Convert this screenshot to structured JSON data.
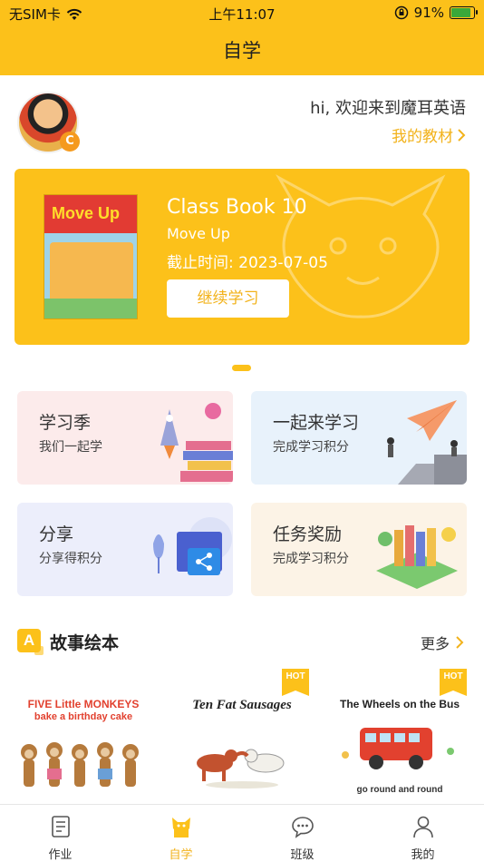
{
  "status_bar": {
    "carrier": "无SIM卡",
    "time": "上午11:07",
    "battery": "91%",
    "battery_level": 0.91
  },
  "nav": {
    "title": "自学"
  },
  "profile": {
    "greeting": "hi, 欢迎来到魔耳英语",
    "my_books_link": "我的教材"
  },
  "banner": {
    "cover_title": "Move Up",
    "title": "Class Book 10",
    "subtitle": "Move Up",
    "deadline": "截止时间: 2023-07-05",
    "continue_button": "继续学习"
  },
  "cards": [
    {
      "title": "学习季",
      "subtitle": "我们一起学",
      "icon": "rocket-books-illustration"
    },
    {
      "title": "一起来学习",
      "subtitle": "完成学习积分",
      "icon": "paper-plane-people-illustration"
    },
    {
      "title": "分享",
      "subtitle": "分享得积分",
      "icon": "share-folder-illustration"
    },
    {
      "title": "任务奖励",
      "subtitle": "完成学习积分",
      "icon": "reward-books-illustration"
    }
  ],
  "section": {
    "title": "故事绘本",
    "icon_letter": "A",
    "more": "更多"
  },
  "stories": [
    {
      "title_line1": "FIVE Little MONKEYS",
      "title_line2": "bake a birthday cake",
      "hot": false
    },
    {
      "title_line1": "Ten Fat Sausages",
      "title_line2": "",
      "hot": true,
      "hot_label": "HOT"
    },
    {
      "title_line1": "The Wheels on the Bus",
      "title_line2": "go round and round",
      "hot": true,
      "hot_label": "HOT"
    }
  ],
  "tabbar": {
    "items": [
      {
        "label": "作业",
        "icon": "document-icon",
        "active": false
      },
      {
        "label": "自学",
        "icon": "fox-icon",
        "active": true
      },
      {
        "label": "班级",
        "icon": "chat-icon",
        "active": false
      },
      {
        "label": "我的",
        "icon": "person-icon",
        "active": false
      }
    ]
  },
  "colors": {
    "accent": "#FCC11A",
    "accent_text": "#F2B21A"
  }
}
